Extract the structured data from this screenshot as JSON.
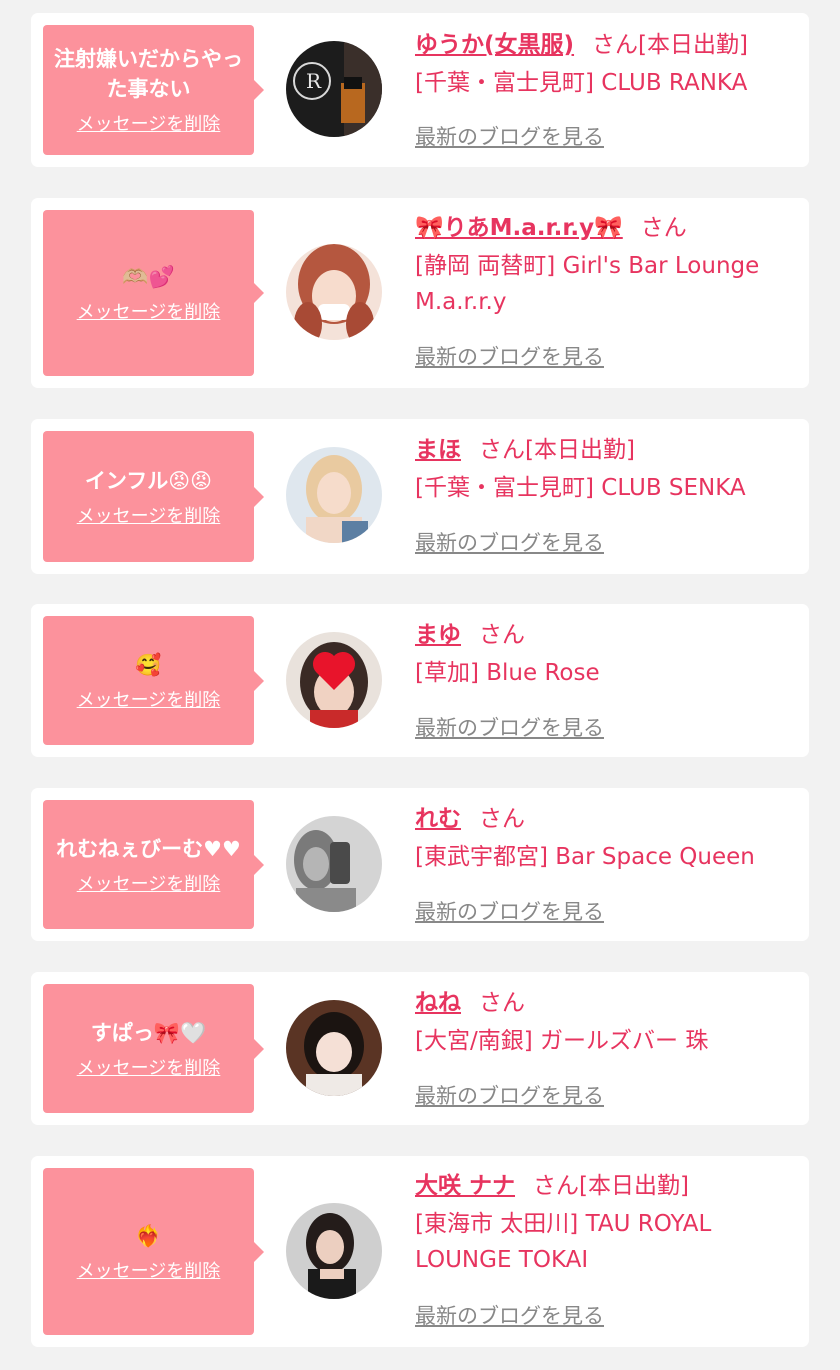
{
  "delete_label": "メッセージを削除",
  "blog_label": "最新のブログを見る",
  "san_label": "さん",
  "colors": {
    "accent": "#e7345f",
    "bubble": "#fc929c",
    "blog_link": "#888888",
    "background": "#f2f2f2"
  },
  "favorites": [
    {
      "message": "注射嫌いだからやった事ない",
      "name": "ゆうか(女黒服)",
      "status": "[本日出勤]",
      "shop": "[千葉・富士見町] CLUB RANKA",
      "avatar": "ranka-logo-avatar"
    },
    {
      "message": "🫶🏼💕",
      "name": "🎀りあM.a.r.r.y🎀",
      "status": "",
      "shop": "[静岡 両替町] Girl's Bar Lounge M.a.r.r.y",
      "avatar": "portrait-avatar"
    },
    {
      "message": "インフル😡😡",
      "name": "まほ",
      "status": "[本日出勤]",
      "shop": "[千葉・富士見町] CLUB SENKA",
      "avatar": "portrait-avatar"
    },
    {
      "message": "🥰",
      "name": "まゆ",
      "status": "",
      "shop": "[草加] Blue Rose",
      "avatar": "heart-sticker-avatar"
    },
    {
      "message": "れむねぇびーむ♥♥",
      "name": "れむ",
      "status": "",
      "shop": "[東武宇都宮] Bar Space Queen",
      "avatar": "mirror-selfie-avatar"
    },
    {
      "message": "すぱっ🎀🤍",
      "name": "ねね",
      "status": "",
      "shop": "[大宮/南銀] ガールズバー 珠",
      "avatar": "portrait-avatar"
    },
    {
      "message": "❤️‍🔥",
      "name": "大咲 ナナ",
      "status": "[本日出勤]",
      "shop": "[東海市 太田川] TAU ROYAL LOUNGE TOKAI",
      "avatar": "portrait-avatar"
    }
  ]
}
